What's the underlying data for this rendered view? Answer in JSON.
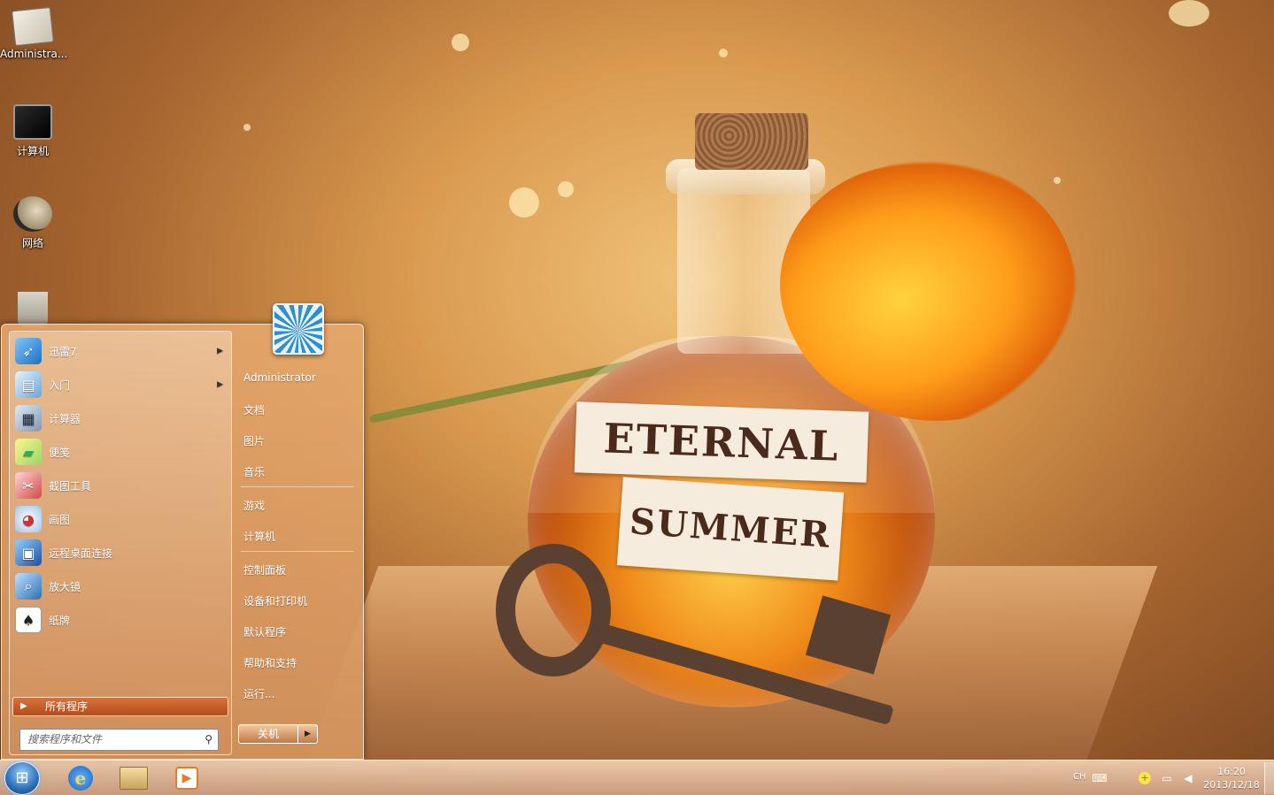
{
  "wallpaper": {
    "label_line1": "ETERNAL",
    "label_line2": "SUMMER"
  },
  "desktop": {
    "icons": [
      {
        "label": "Administra...",
        "icon": "user-folder-icon"
      },
      {
        "label": "计算机",
        "icon": "computer-icon"
      },
      {
        "label": "网络",
        "icon": "network-icon"
      },
      {
        "label": "",
        "icon": "recycle-bin-icon"
      }
    ]
  },
  "start_menu": {
    "pinned": [
      {
        "label": "迅雷7",
        "icon": "thunder-icon",
        "has_submenu": true
      },
      {
        "label": "入门",
        "icon": "getting-started-icon",
        "has_submenu": true
      },
      {
        "label": "计算器",
        "icon": "calculator-icon",
        "has_submenu": false
      },
      {
        "label": "便笺",
        "icon": "sticky-notes-icon",
        "has_submenu": false
      },
      {
        "label": "截图工具",
        "icon": "snipping-tool-icon",
        "has_submenu": false
      },
      {
        "label": "画图",
        "icon": "paint-icon",
        "has_submenu": false
      },
      {
        "label": "远程桌面连接",
        "icon": "remote-desktop-icon",
        "has_submenu": false
      },
      {
        "label": "放大镜",
        "icon": "magnifier-icon",
        "has_submenu": false
      },
      {
        "label": "纸牌",
        "icon": "solitaire-icon",
        "has_submenu": false
      }
    ],
    "all_programs": "所有程序",
    "search_placeholder": "搜索程序和文件",
    "user_name": "Administrator",
    "right_items": [
      "文档",
      "图片",
      "音乐",
      "游戏",
      "计算机",
      "控制面板",
      "设备和打印机",
      "默认程序",
      "帮助和支持",
      "运行..."
    ],
    "shutdown_label": "关机"
  },
  "taskbar": {
    "pinned": [
      "internet-explorer-icon",
      "windows-explorer-icon",
      "media-player-icon"
    ],
    "language": "CH",
    "time": "16:20",
    "date": "2013/12/18"
  },
  "colors": {
    "taskbar": "#d8a887",
    "start_menu": "#e0a46c",
    "all_programs": "#c85f2b",
    "accent_blue": "#2d6fb7"
  }
}
